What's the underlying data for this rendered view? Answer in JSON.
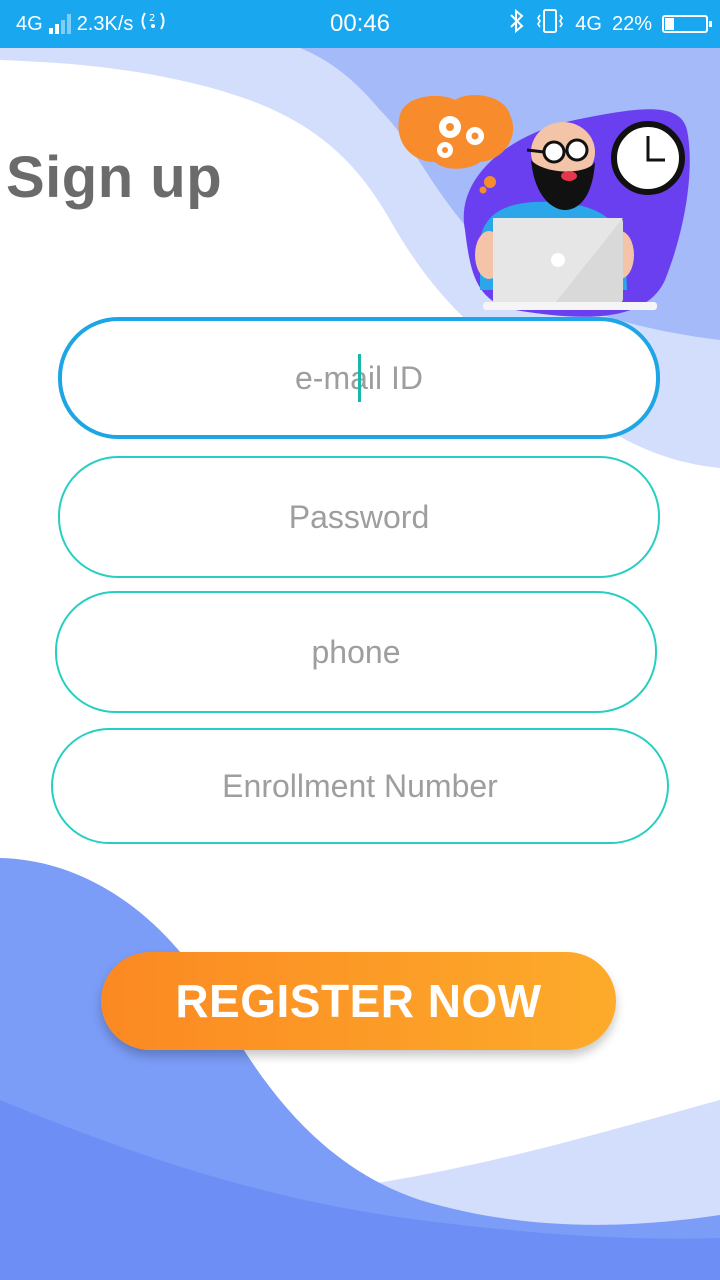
{
  "status_bar": {
    "network": "4G",
    "speed": "2.3K/s",
    "time": "00:46",
    "network_right": "4G",
    "battery_text": "22%",
    "battery_level": 0.22,
    "icons": [
      "signal-icon",
      "hotspot-icon",
      "bluetooth-icon",
      "vibrate-icon",
      "battery-icon"
    ]
  },
  "page": {
    "title": "Sign up"
  },
  "form": {
    "email": {
      "placeholder": "e-mail ID",
      "value": ""
    },
    "password": {
      "placeholder": "Password",
      "value": ""
    },
    "phone": {
      "placeholder": "phone",
      "value": ""
    },
    "enrollment": {
      "placeholder": "Enrollment Number",
      "value": ""
    }
  },
  "actions": {
    "register_label": "REGISTER NOW"
  },
  "colors": {
    "status_bar": "#19a7f0",
    "field_border": "#26cfc2",
    "field_focus_border": "#1ea5e6",
    "button_start": "#fb8922",
    "button_end": "#fdab2b",
    "wave_blue": "#7b9cf7",
    "wave_light": "#d3defc",
    "title": "#6b6b6b"
  }
}
